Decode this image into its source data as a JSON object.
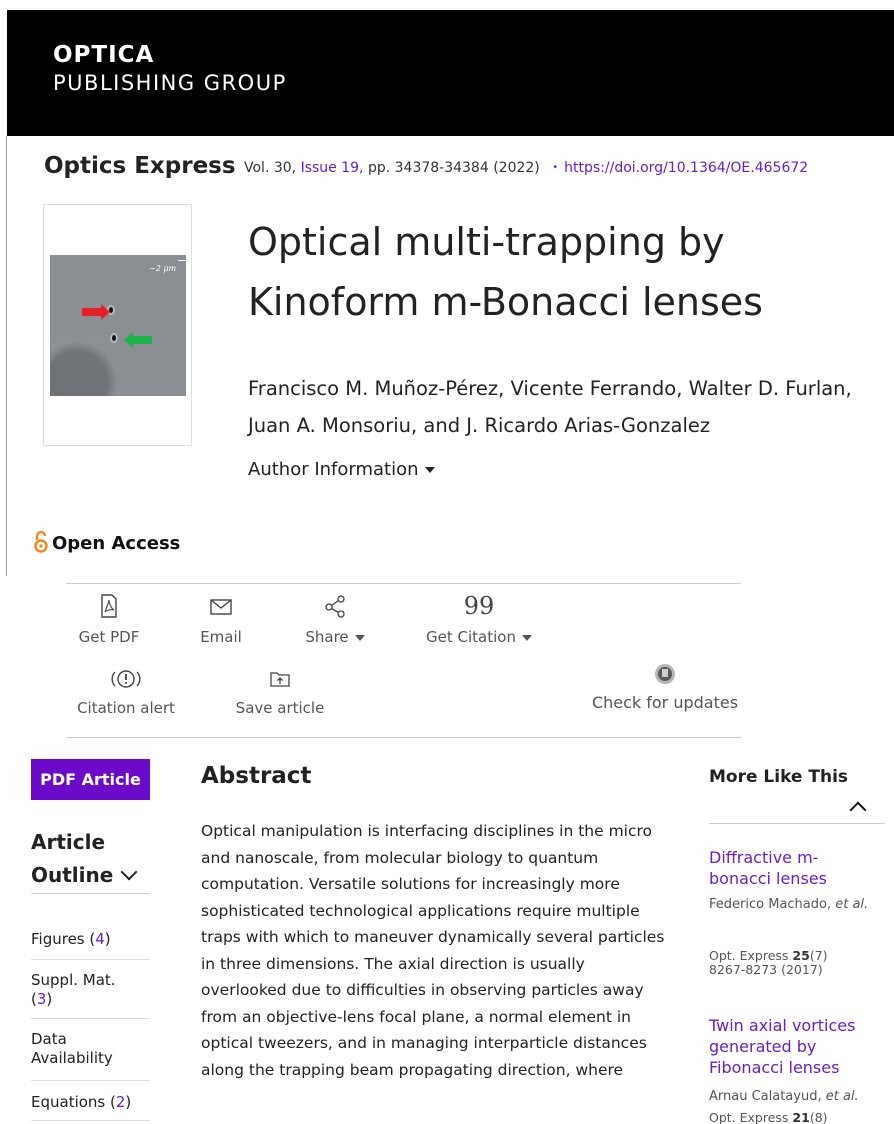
{
  "header": {
    "logo_line1": "OPTICA",
    "logo_line2": "PUBLISHING GROUP"
  },
  "citation_bar": {
    "journal": "Optics Express",
    "volume": "Vol. 30,",
    "issue": "Issue 19,",
    "pages": "pp. 34378-34384",
    "year": "(2022)",
    "separator": "•",
    "doi": "https://doi.org/10.1364/OE.465672"
  },
  "cover": {
    "scale_label": "~2 μm"
  },
  "article": {
    "title": "Optical multi-trapping by Kinoform m-Bonacci lenses",
    "authors_line1": "Francisco M. Muñoz-Pérez, Vicente Ferrando, Walter D. Furlan,",
    "authors_line2": "Juan A. Monsoriu, and J. Ricardo Arias-Gonzalez",
    "author_info": "Author Information",
    "open_access": "Open Access"
  },
  "toolbar": {
    "get_pdf": "Get PDF",
    "email": "Email",
    "share": "Share",
    "get_citation": "Get Citation",
    "citation_alert": "Citation alert",
    "save_article": "Save article",
    "check_updates": "Check for updates"
  },
  "sidebar": {
    "pdf_button": "PDF Article",
    "outline_title_1": "Article",
    "outline_title_2": "Outline",
    "items": [
      {
        "label": "Figures",
        "count": "4"
      },
      {
        "label": "Suppl. Mat.",
        "count": "3"
      },
      {
        "label": "Data Availability",
        "count": ""
      },
      {
        "label": "Equations",
        "count": "2"
      }
    ]
  },
  "abstract": {
    "heading": "Abstract",
    "text": "Optical manipulation is interfacing disciplines in the micro and nanoscale, from molecular biology to quantum computation. Versatile solutions for increasingly more sophisticated technological applications require multiple traps with which to maneuver dynamically several particles in three dimensions. The axial direction is usually overlooked due to difficulties in observing particles away from an objective-lens focal plane, a normal element in optical tweezers, and in managing interparticle distances along the trapping beam propagating direction, where"
  },
  "more_like_this": {
    "heading": "More Like This",
    "items": [
      {
        "title": "Diffractive m-bonacci lenses",
        "author": "Federico Machado,",
        "etal": "et al.",
        "journal": "Opt. Express",
        "vol": "25",
        "issue": "(7)",
        "pages": "8267-8273 (2017)"
      },
      {
        "title": "Twin axial vortices generated by Fibonacci lenses",
        "author": "Arnau Calatayud,",
        "etal": "et al.",
        "journal": "Opt. Express",
        "vol": "21",
        "issue": "(8)",
        "pages": ""
      }
    ]
  },
  "colors": {
    "accent": "#6b0ac9",
    "link": "#6a1dc0",
    "open_access": "#f68212"
  }
}
